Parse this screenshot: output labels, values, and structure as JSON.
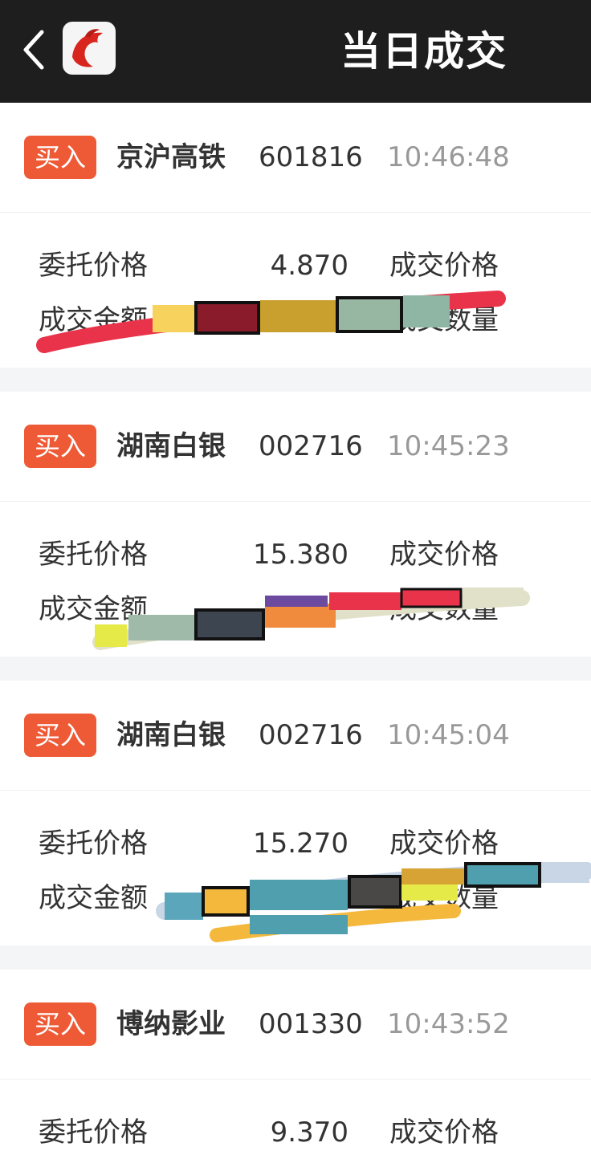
{
  "header": {
    "title": "当日成交",
    "back_icon": "chevron-left-icon",
    "logo_icon": "dolphin-logo-icon"
  },
  "colors": {
    "header_bg": "#1e1e1e",
    "buy_badge": "#ee5a36",
    "time_text": "#999999",
    "page_bg": "#f4f5f7"
  },
  "labels": {
    "order_price": "委托价格",
    "deal_price": "成交价格",
    "deal_amount": "成交金额",
    "deal_quantity": "成交数量"
  },
  "trades": [
    {
      "side": "买入",
      "name": "京沪高铁",
      "code": "601816",
      "time": "10:46:48",
      "order_price": "4.870"
    },
    {
      "side": "买入",
      "name": "湖南白银",
      "code": "002716",
      "time": "10:45:23",
      "order_price": "15.380"
    },
    {
      "side": "买入",
      "name": "湖南白银",
      "code": "002716",
      "time": "10:45:04",
      "order_price": "15.270"
    },
    {
      "side": "买入",
      "name": "博纳影业",
      "code": "001330",
      "time": "10:43:52",
      "order_price": "9.370"
    }
  ]
}
